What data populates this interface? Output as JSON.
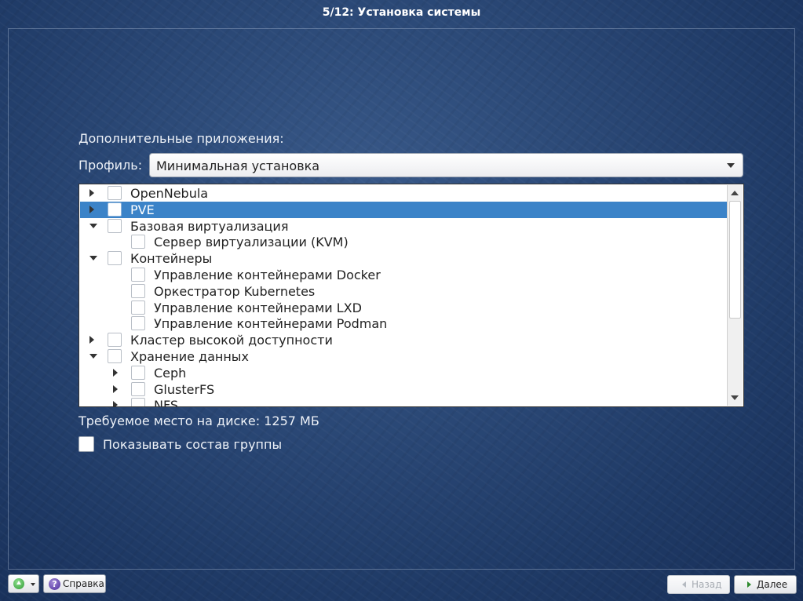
{
  "window": {
    "title": "5/12: Установка системы"
  },
  "main": {
    "section_label": "Дополнительные приложения:",
    "profile_label": "Профиль:",
    "profile_value": "Минимальная установка",
    "disk_info": "Требуемое место на диске: 1257 МБ",
    "show_group_label": "Показывать состав группы"
  },
  "tree": {
    "items": [
      {
        "label": "OpenNebula",
        "expander": "collapsed",
        "level": 0,
        "checked": false,
        "selected": false
      },
      {
        "label": "PVE",
        "expander": "collapsed",
        "level": 0,
        "checked": false,
        "selected": true
      },
      {
        "label": "Базовая виртуализация",
        "expander": "expanded",
        "level": 0,
        "checked": false,
        "selected": false
      },
      {
        "label": "Сервер виртуализации (KVM)",
        "expander": "none",
        "level": 1,
        "checked": false,
        "selected": false
      },
      {
        "label": "Контейнеры",
        "expander": "expanded",
        "level": 0,
        "checked": false,
        "selected": false
      },
      {
        "label": "Управление контейнерами Docker",
        "expander": "none",
        "level": 1,
        "checked": false,
        "selected": false
      },
      {
        "label": "Оркестратор Kubernetes",
        "expander": "none",
        "level": 1,
        "checked": false,
        "selected": false
      },
      {
        "label": "Управление контейнерами LXD",
        "expander": "none",
        "level": 1,
        "checked": false,
        "selected": false
      },
      {
        "label": "Управление контейнерами Podman",
        "expander": "none",
        "level": 1,
        "checked": false,
        "selected": false
      },
      {
        "label": "Кластер высокой доступности",
        "expander": "collapsed",
        "level": 0,
        "checked": false,
        "selected": false
      },
      {
        "label": "Хранение данных",
        "expander": "expanded",
        "level": 0,
        "checked": false,
        "selected": false
      },
      {
        "label": "Ceph",
        "expander": "collapsed",
        "level": 1,
        "checked": false,
        "selected": false
      },
      {
        "label": "GlusterFS",
        "expander": "collapsed",
        "level": 1,
        "checked": false,
        "selected": false
      },
      {
        "label": "NFS",
        "expander": "collapsed",
        "level": 1,
        "checked": false,
        "selected": false
      }
    ]
  },
  "footer": {
    "extra_icon": "green-up-arrow-icon",
    "help_label": "Справка",
    "help_icon": "question-icon",
    "back_label": "Назад",
    "back_enabled": false,
    "next_label": "Далее"
  }
}
